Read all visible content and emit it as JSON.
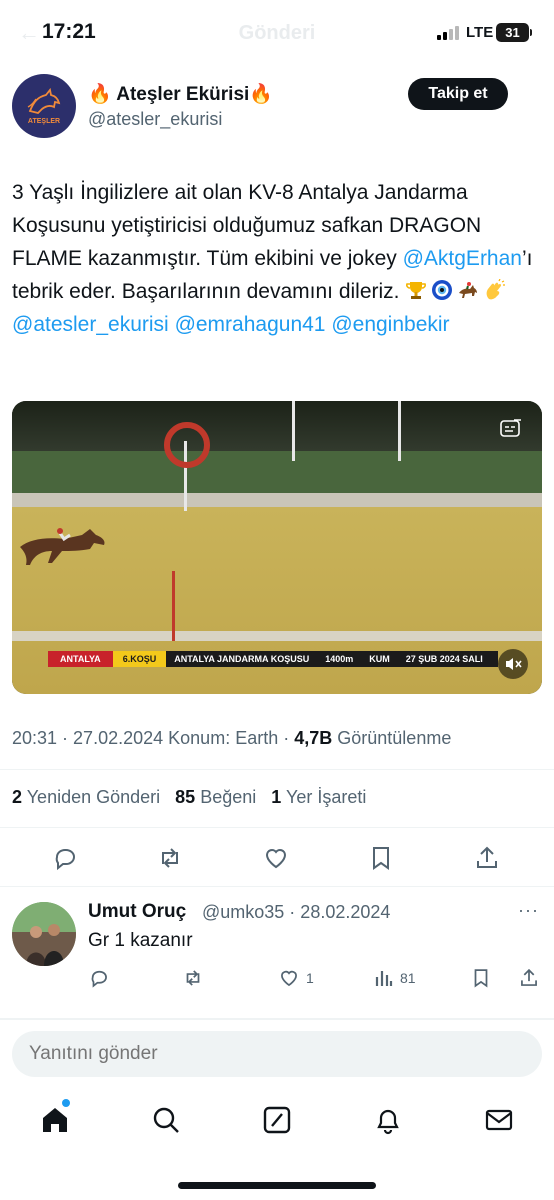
{
  "status_bar": {
    "time": "17:21",
    "network": "LTE",
    "battery": "31",
    "faded_title": "Gönderi"
  },
  "tweet": {
    "author": {
      "display_name": "🔥 Ateşler Ekürisi🔥",
      "handle": "@atesler_ekurisi",
      "avatar_text": "ATEŞLER"
    },
    "follow_label": "Takip et",
    "text": {
      "part1": "3 Yaşlı İngilizlere ait olan KV-8 Antalya Jandarma Koşusunu yetiştiricisi olduğumuz safkan DRAGON FLAME kazanmıştır. Tüm ekibini ve jokey ",
      "mention1": "@AktgErhan",
      "part2": "’ı tebrik eder. Başarılarının devamını dileriz.",
      "emojis": [
        "trophy",
        "nazar",
        "horse-racing",
        "clapping-hands"
      ],
      "mention2": "@atesler_ekurisi",
      "mention3": "@emrahagun41",
      "mention4": "@enginbekir"
    },
    "video": {
      "lower_third": {
        "city": "ANTALYA",
        "race": "6.KOŞU",
        "race_name": "ANTALYA JANDARMA KOŞUSU",
        "distance": "1400m",
        "surface": "KUM",
        "date": "27 ŞUB 2024 SALI"
      }
    },
    "meta": {
      "time": "20:31",
      "date": "27.02.2024",
      "location": "Konum: Earth",
      "views_count": "4,7B",
      "views_label": "Görüntülenme"
    },
    "stats": {
      "retweets_count": "2",
      "retweets_label": "Yeniden Gönderi",
      "likes_count": "85",
      "likes_label": "Beğeni",
      "bookmarks_count": "1",
      "bookmarks_label": "Yer İşareti"
    }
  },
  "reply": {
    "display_name": "Umut Oruç",
    "handle_date": "@umko35 · 28.02.2024",
    "text": "Gr 1 kazanır",
    "like_count": "1",
    "view_count": "81",
    "more": "···"
  },
  "compose": {
    "placeholder": "Yanıtını gönder"
  },
  "colors": {
    "link": "#1d9bf0",
    "text": "#0f1419",
    "secondary": "#536471"
  }
}
